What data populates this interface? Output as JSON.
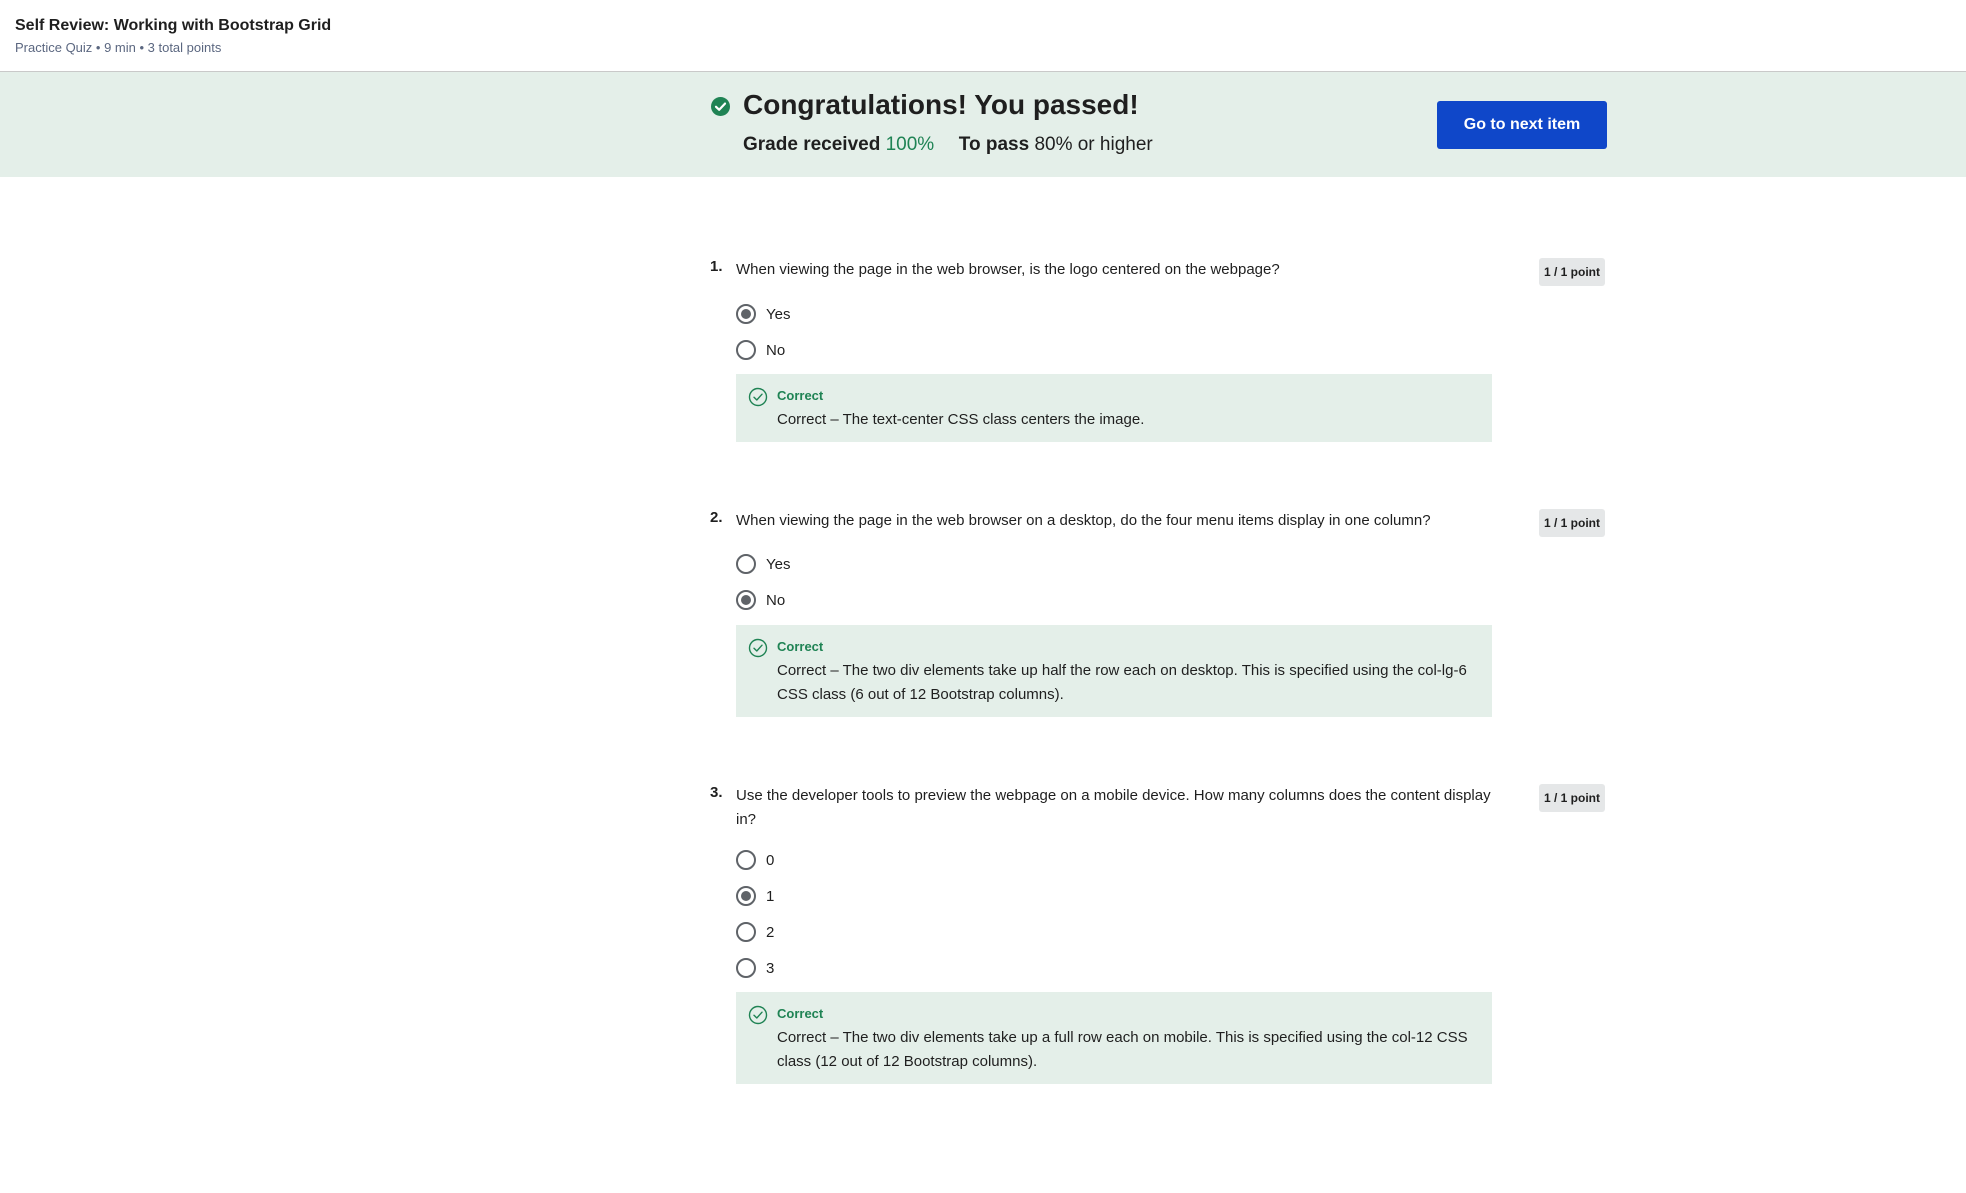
{
  "header": {
    "title": "Self Review: Working with Bootstrap Grid",
    "subtitle": "Practice Quiz • 9 min • 3 total points"
  },
  "banner": {
    "headline": "Congratulations! You passed!",
    "grade_label": "Grade received",
    "grade_value": "100%",
    "pass_label": "To pass",
    "pass_value": "80% or higher",
    "next_button": "Go to next item"
  },
  "questions": [
    {
      "number": "1.",
      "text": "When viewing the page in the web browser, is the logo centered on the webpage?",
      "points": "1 / 1 point",
      "options": [
        {
          "label": "Yes",
          "selected": true
        },
        {
          "label": "No",
          "selected": false
        }
      ],
      "feedback_title": "Correct",
      "feedback_text": "Correct – The text-center CSS class centers the image."
    },
    {
      "number": "2.",
      "text": "When viewing the page in the web browser on a desktop, do the four menu items display in one column?",
      "points": "1 / 1 point",
      "options": [
        {
          "label": "Yes",
          "selected": false
        },
        {
          "label": "No",
          "selected": true
        }
      ],
      "feedback_title": "Correct",
      "feedback_text": "Correct – The two div elements take up half the row each on desktop. This is specified using the col-lg-6 CSS class (6 out of 12 Bootstrap columns)."
    },
    {
      "number": "3.",
      "text": "Use the developer tools to preview the webpage on a mobile device. How many columns does the content display in?",
      "points": "1 / 1 point",
      "options": [
        {
          "label": "0",
          "selected": false
        },
        {
          "label": "1",
          "selected": true
        },
        {
          "label": "2",
          "selected": false
        },
        {
          "label": "3",
          "selected": false
        }
      ],
      "feedback_title": "Correct",
      "feedback_text": "Correct – The two div elements take up a full row each on mobile. This is specified using the col-12 CSS class (12 out of 12 Bootstrap columns)."
    }
  ],
  "colors": {
    "accent_green": "#1f8354",
    "banner_bg": "#e4efe9",
    "primary_button": "#0f47c9"
  }
}
